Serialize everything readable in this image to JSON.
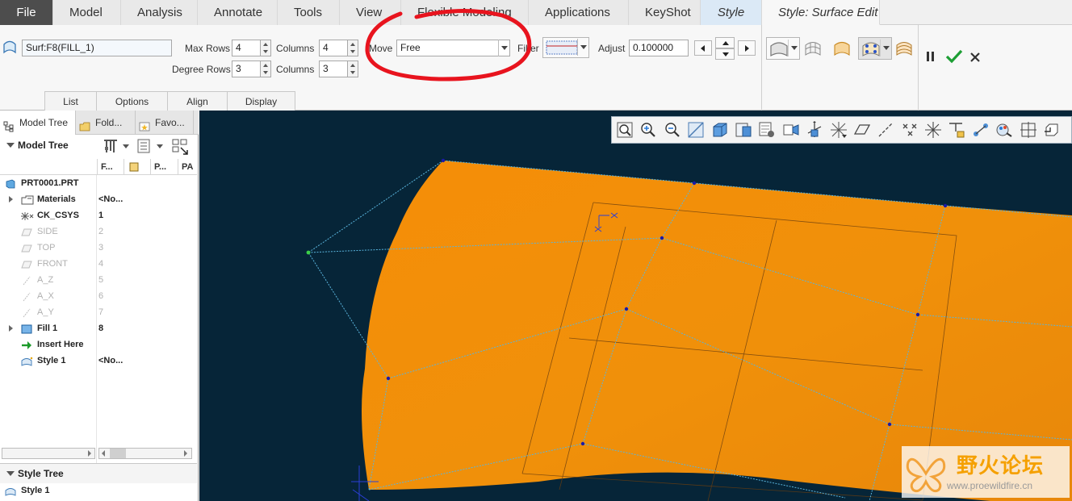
{
  "menu_tabs": [
    "File",
    "Model",
    "Analysis",
    "Annotate",
    "Tools",
    "View",
    "Flexible Modeling",
    "Applications",
    "KeyShot",
    "Style",
    "Style: Surface Edit"
  ],
  "ribbon": {
    "surface_field": "Surf:F8(FILL_1)",
    "max_rows_label": "Max Rows",
    "max_rows_value": "4",
    "columns_label_1": "Columns",
    "columns_value_1": "4",
    "degree_rows_label": "Degree Rows",
    "degree_rows_value": "3",
    "columns_label_2": "Columns",
    "columns_value_2": "3",
    "move_label": "Move",
    "move_value": "Free",
    "filter_label": "Filter",
    "adjust_label": "Adjust",
    "adjust_value": "0.100000",
    "sub_tabs": [
      "List",
      "Options",
      "Align",
      "Display"
    ],
    "annotation_color": "#e8141e"
  },
  "left_panel": {
    "tabs": [
      "Model Tree",
      "Fold...",
      "Favo..."
    ],
    "model_tree_header": "Model Tree",
    "columns": [
      "F...",
      "",
      "P...",
      "PA"
    ],
    "root": "PRT0001.PRT",
    "items": [
      {
        "name": "Materials",
        "value": "<No...",
        "dim": false,
        "expand": true,
        "icon": "materials-icon"
      },
      {
        "name": "CK_CSYS",
        "value": "1",
        "dim": false,
        "expand": false,
        "icon": "csys-icon"
      },
      {
        "name": "SIDE",
        "value": "2",
        "dim": true,
        "expand": false,
        "icon": "datum-plane-icon"
      },
      {
        "name": "TOP",
        "value": "3",
        "dim": true,
        "expand": false,
        "icon": "datum-plane-icon"
      },
      {
        "name": "FRONT",
        "value": "4",
        "dim": true,
        "expand": false,
        "icon": "datum-plane-icon"
      },
      {
        "name": "A_Z",
        "value": "5",
        "dim": true,
        "expand": false,
        "icon": "datum-axis-icon"
      },
      {
        "name": "A_X",
        "value": "6",
        "dim": true,
        "expand": false,
        "icon": "datum-axis-icon"
      },
      {
        "name": "A_Y",
        "value": "7",
        "dim": true,
        "expand": false,
        "icon": "datum-axis-icon"
      },
      {
        "name": "Fill 1",
        "value": "8",
        "dim": false,
        "expand": true,
        "icon": "fill-icon"
      },
      {
        "name": "Insert Here",
        "value": "",
        "dim": false,
        "expand": false,
        "icon": "insert-arrow-icon"
      },
      {
        "name": "Style 1",
        "value": "<No...",
        "dim": false,
        "expand": false,
        "icon": "style-icon"
      }
    ],
    "style_tree_header": "Style Tree",
    "style_tree_items": [
      "Style 1"
    ]
  },
  "viewport": {
    "background": "#062538",
    "surface_color": "#f0900a",
    "control_mesh_color": "#5ab4dc"
  },
  "watermark": {
    "chinese": "野火论坛",
    "url": "www.proewildfire.cn"
  }
}
